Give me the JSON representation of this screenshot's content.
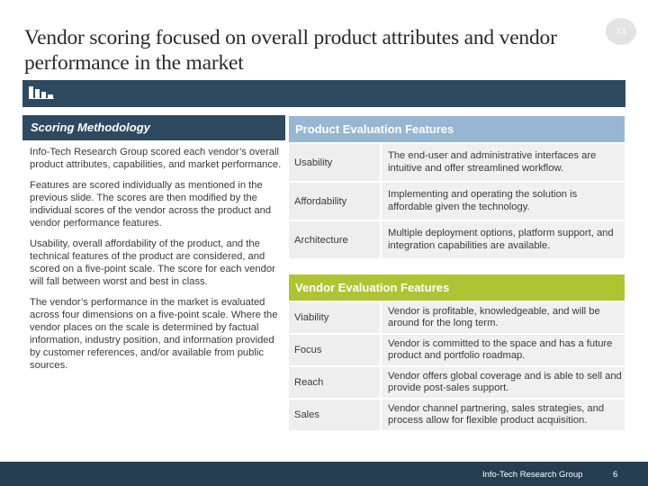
{
  "slide": {
    "title": "Vendor scoring focused on overall product attributes and vendor performance in the market",
    "section_badge": "2.1",
    "banner_icon": "bar-chart-logo-icon"
  },
  "scoring_methodology": {
    "heading": "Scoring Methodology",
    "paragraphs": [
      "Info-Tech Research Group scored each vendor’s overall product attributes, capabilities, and market performance.",
      "Features are scored individually as mentioned in the previous slide. The scores are then modified by the individual scores of the vendor across the product and vendor performance features.",
      "Usability, overall affordability of the product, and the technical features of the product are considered, and scored on a five-point scale. The score for each vendor will fall between worst and best in class.",
      "The vendor’s performance in the market is evaluated across four dimensions on a five-point scale. Where the vendor places on the scale is determined by factual information, industry position, and information provided by customer references, and/or available from public sources."
    ]
  },
  "product_evaluation": {
    "heading": "Product Evaluation Features",
    "rows": [
      {
        "name": "Usability",
        "description": "The end-user and administrative interfaces are intuitive and offer streamlined workflow."
      },
      {
        "name": "Affordability",
        "description": "Implementing and operating the solution is affordable given the technology."
      },
      {
        "name": "Architecture",
        "description": "Multiple deployment options, platform support, and integration capabilities are available."
      }
    ]
  },
  "vendor_evaluation": {
    "heading": "Vendor Evaluation Features",
    "rows": [
      {
        "name": "Viability",
        "description": "Vendor is profitable, knowledgeable, and will be around for the long term."
      },
      {
        "name": "Focus",
        "description": "Vendor is committed to the space and has a future product and portfolio roadmap."
      },
      {
        "name": "Reach",
        "description": "Vendor offers global coverage and is able to sell and provide post-sales support."
      },
      {
        "name": "Sales",
        "description": "Vendor channel partnering, sales strategies, and process allow for flexible product acquisition."
      }
    ]
  },
  "footer": {
    "organization": "Info-Tech Research Group",
    "page_number": "6"
  },
  "colors": {
    "navy": "#2e4a60",
    "footer_navy": "#263e52",
    "product_header_blue": "#96b6d2",
    "vendor_header_green": "#b0c433",
    "cell_gray": "#eeeeee"
  }
}
